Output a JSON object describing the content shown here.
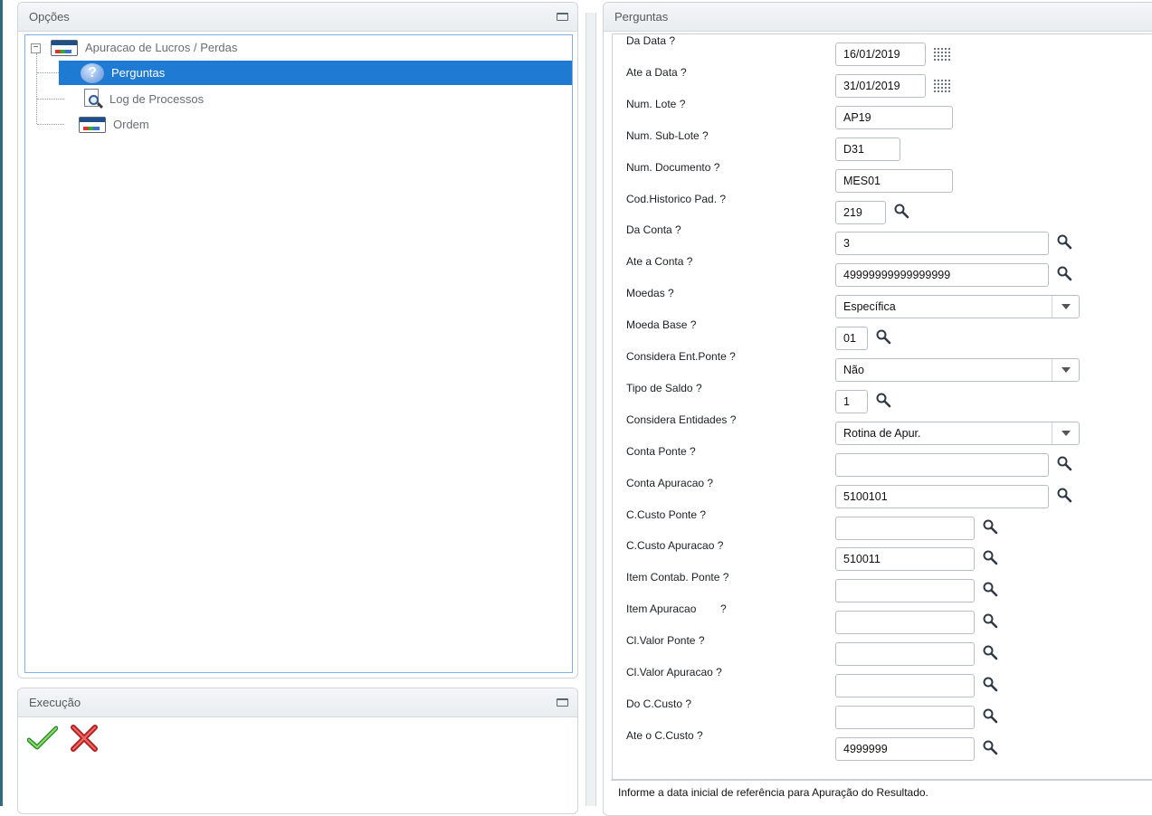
{
  "left_panel": {
    "options_title": "Opções",
    "tree": {
      "root_label": "Apuracao de Lucros / Perdas",
      "items": [
        {
          "label": "Perguntas",
          "icon": "question-icon",
          "selected": true
        },
        {
          "label": "Log de Processos",
          "icon": "log-search-icon",
          "selected": false
        },
        {
          "label": "Ordem",
          "icon": "window-icon",
          "selected": false
        }
      ]
    },
    "execution_title": "Execução"
  },
  "right_panel": {
    "title": "Perguntas",
    "questions": [
      {
        "label": "Da Data ?",
        "type": "date",
        "value": "16/01/2019"
      },
      {
        "label": "Ate a Data ?",
        "type": "date",
        "value": "31/01/2019"
      },
      {
        "label": "Num. Lote ?",
        "type": "text",
        "value": "AP19"
      },
      {
        "label": "Num. Sub-Lote ?",
        "type": "text",
        "value": "D31"
      },
      {
        "label": "Num. Documento ?",
        "type": "text",
        "value": "MES01"
      },
      {
        "label": "Cod.Historico Pad. ?",
        "type": "lookup",
        "value": "219"
      },
      {
        "label": "Da Conta ?",
        "type": "lookup",
        "value": "3"
      },
      {
        "label": "Ate a Conta ?",
        "type": "lookup",
        "value": "49999999999999999"
      },
      {
        "label": "Moedas ?",
        "type": "select",
        "value": "Específica"
      },
      {
        "label": "Moeda Base ?",
        "type": "lookup",
        "value": "01"
      },
      {
        "label": "Considera Ent.Ponte ?",
        "type": "select",
        "value": "Não"
      },
      {
        "label": "Tipo de Saldo ?",
        "type": "lookup",
        "value": "1"
      },
      {
        "label": "Considera Entidades ?",
        "type": "select",
        "value": "Rotina de Apur."
      },
      {
        "label": "Conta Ponte ?",
        "type": "lookup",
        "value": ""
      },
      {
        "label": "Conta Apuracao ?",
        "type": "lookup",
        "value": "5100101"
      },
      {
        "label": "C.Custo Ponte ?",
        "type": "lookup",
        "value": ""
      },
      {
        "label": "C.Custo Apuracao ?",
        "type": "lookup",
        "value": "510011"
      },
      {
        "label": "Item Contab. Ponte ?",
        "type": "lookup",
        "value": ""
      },
      {
        "label": "Item Apuracao        ?",
        "type": "lookup",
        "value": ""
      },
      {
        "label": "Cl.Valor Ponte ?",
        "type": "lookup",
        "value": ""
      },
      {
        "label": "Cl.Valor Apuracao ?",
        "type": "lookup",
        "value": ""
      },
      {
        "label": "Do C.Custo ?",
        "type": "lookup",
        "value": ""
      },
      {
        "label": "Ate o C.Custo ?",
        "type": "lookup",
        "value": "4999999"
      }
    ],
    "status_text": "Informe a data inicial de referência para Apuração do Resultado."
  }
}
